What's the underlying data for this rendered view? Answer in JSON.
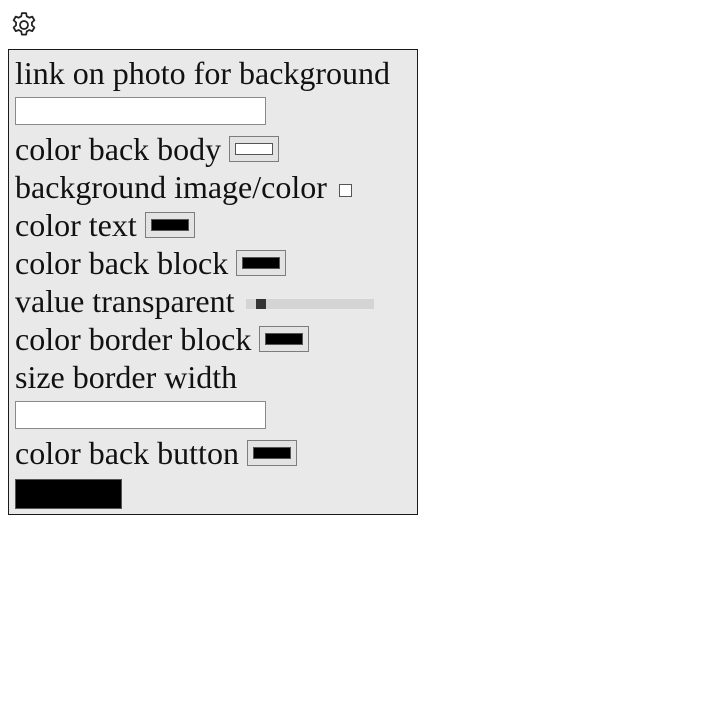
{
  "settings_icon": "gear-icon",
  "panel": {
    "link_label": "link on photo for background",
    "link_value": "",
    "color_back_body_label": "color back body",
    "color_back_body_value": "#ffffff",
    "bg_toggle_label": "background image/color",
    "bg_toggle_checked": false,
    "color_text_label": "color text",
    "color_text_value": "#000000",
    "color_back_block_label": "color back block",
    "color_back_block_value": "#000000",
    "transparent_label": "value transparent",
    "transparent_value": 0.11,
    "color_border_label": "color border block",
    "color_border_value": "#000000",
    "border_width_label": "size border width",
    "border_width_value": "",
    "color_back_button_label": "color back button",
    "color_back_button_value": "#000000",
    "button_color": "#000000"
  }
}
